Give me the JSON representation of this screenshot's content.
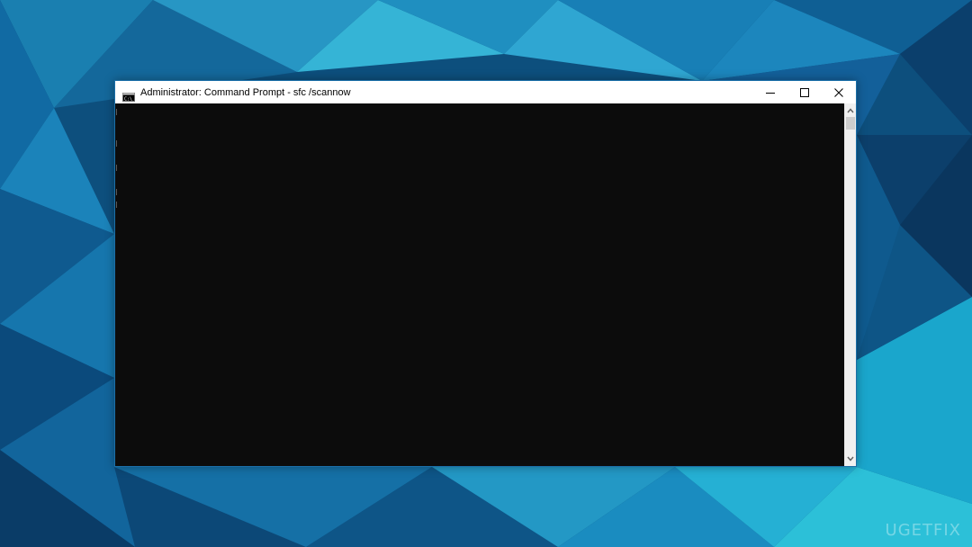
{
  "window": {
    "title": "Administrator: Command Prompt - sfc  /scannow",
    "icon": "cmd-console-icon",
    "controls": {
      "minimize_icon": "minimize-icon",
      "maximize_icon": "maximize-icon",
      "close_icon": "close-icon"
    }
  },
  "console": {
    "background": "#0c0c0c",
    "output": ""
  },
  "scrollbar": {
    "up_icon": "scroll-up-arrow-icon",
    "down_icon": "scroll-down-arrow-icon"
  },
  "watermark": {
    "text": "UGETFIX"
  },
  "colors": {
    "titlebar": "#ffffff",
    "window_border": "#1b6fa8",
    "wallpaper_dark": "#0a3d66",
    "wallpaper_light": "#1fb6d1"
  }
}
